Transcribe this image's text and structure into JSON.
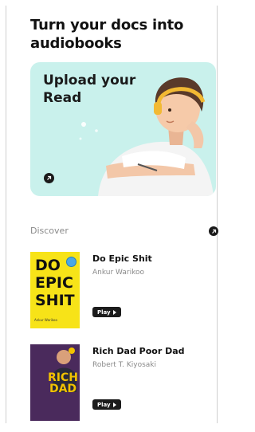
{
  "header": {
    "title": "Turn your docs into audiobooks"
  },
  "hero": {
    "text": "Upload your Read",
    "arrow_icon": "arrow-circle-icon"
  },
  "discover": {
    "label": "Discover",
    "books": [
      {
        "title": "Do Epic Shit",
        "author": "Ankur Warikoo",
        "play_label": "Play",
        "cover_lines": [
          "DO",
          "EPIC",
          "SHIT"
        ],
        "cover_small": "Ankur Warikoo"
      },
      {
        "title": "Rich Dad Poor Dad",
        "author": "Robert T. Kiyosaki",
        "play_label": "Play",
        "cover_lines": [
          "RICH",
          "DAD"
        ]
      }
    ]
  },
  "colors": {
    "hero_bg": "#c9f1ec",
    "cover1": "#f7e318",
    "cover2": "#4a2a5c",
    "play_bg": "#1c1c1c"
  }
}
